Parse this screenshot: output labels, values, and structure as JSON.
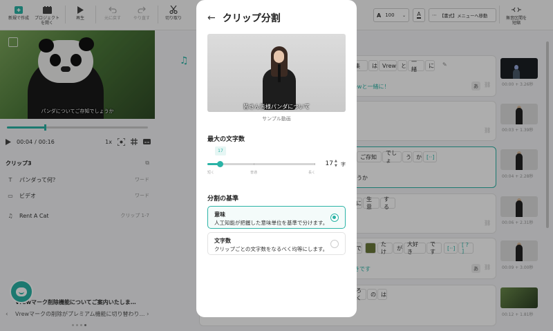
{
  "toolbar": {
    "new_project": "新規で作成",
    "open_project": "プロジェクトを開く",
    "play": "再生",
    "undo": "元に戻す",
    "redo": "やり直す",
    "cut": "切り取り",
    "font_size": "100",
    "format_menu": "【書式】メニューへ移動",
    "silence_cut": "無音区間を短縮"
  },
  "preview": {
    "caption": "パンダについてご存知でしょうか",
    "time_current": "00:04",
    "time_sep": "/",
    "time_total": "00:16",
    "speed": "1x",
    "progress": 0.27
  },
  "clip_panel": {
    "title": "クリップ3",
    "items": [
      {
        "icon": "text-icon",
        "label": "パンダって何？",
        "tag": "ワード"
      },
      {
        "icon": "video-icon",
        "label": "ビデオ",
        "tag": "ワード"
      },
      {
        "icon": "music-icon",
        "label": "Rent A Cat",
        "tag": "クリップ 1-7"
      }
    ]
  },
  "notice": {
    "title": "Vrewマーク削除機能についてご案内いたしま…",
    "body": "Vrewマークの削除がプレミアム機能に切り替わり…"
  },
  "editor": {
    "clip1": {
      "words": [
        "集",
        "は",
        "Vrew",
        "と",
        "一緒",
        "に"
      ],
      "line": "ewと一緒に！",
      "badge": "あ",
      "thumb_time": "00:00 + 3.26秒"
    },
    "clip2": {
      "thumb_time": "00:03 + 1.39秒"
    },
    "clip3": {
      "words": [
        "ご存知",
        "でしょ",
        "う",
        "か",
        "[··]"
      ],
      "line": "うか",
      "thumb_time": "00:04 + 2.28秒"
    },
    "clip4": {
      "words": [
        "に",
        "生意",
        "する"
      ],
      "thumb_time": "00:06 + 2.31秒"
    },
    "clip5": {
      "words": [
        "で",
        "たけ",
        "が",
        "大好き",
        "です",
        "[··]",
        "[ ? ]"
      ],
      "line": "きです",
      "badge": "あ",
      "thumb_time": "00:09 + 3.00秒"
    },
    "clip6": {
      "words": [
        "ろく",
        "の",
        "は"
      ],
      "thumb_time": "00:12 + 1.81秒"
    }
  },
  "modal": {
    "title": "クリップ分割",
    "sample_caption": "皆さん皆様パンダについて",
    "sample_label": "サンプル動画",
    "max_chars_label": "最大の文字数",
    "slider_value": "17",
    "slider_fraction": 0.12,
    "scale_short": "短く",
    "scale_normal": "普通",
    "scale_long": "長く",
    "input_value": "17",
    "unit": "字",
    "criteria_label": "分割の基準",
    "options": [
      {
        "title": "意味",
        "desc": "人工知能が把握した意味単位を基準で分けます。",
        "selected": true
      },
      {
        "title": "文字数",
        "desc": "クリップごとの文字数をなるべく均等にします。",
        "selected": false
      }
    ]
  },
  "colors": {
    "accent": "#2ab3a6"
  }
}
